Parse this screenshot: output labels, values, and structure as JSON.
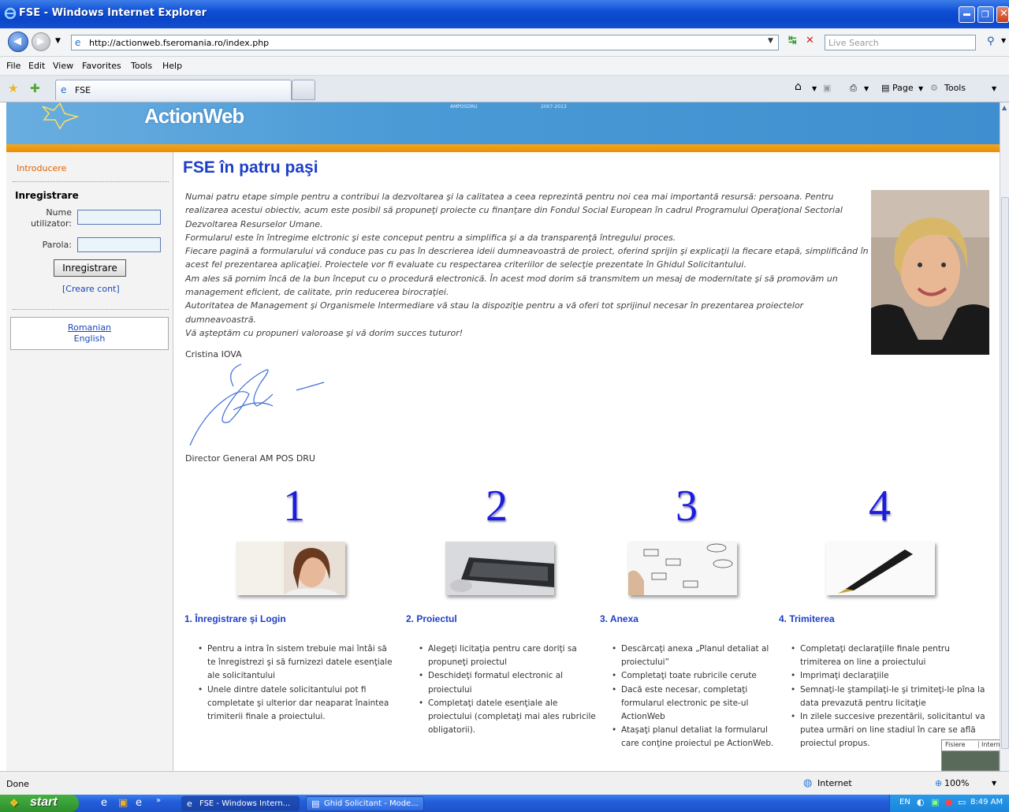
{
  "window": {
    "title": "FSE - Windows Internet Explorer"
  },
  "addressbar": {
    "url": "http://actionweb.fseromania.ro/index.php",
    "search_placeholder": "Live Search"
  },
  "menu": {
    "items": [
      "File",
      "Edit",
      "View",
      "Favorites",
      "Tools",
      "Help"
    ]
  },
  "tabbar": {
    "tab_label": "FSE",
    "page_label": "Page",
    "tools_label": "Tools"
  },
  "banner": {
    "logo": "ActionWeb",
    "small_left": "AMPOSDRU",
    "small_right": "2007-2013"
  },
  "sidebar": {
    "intro": "Introducere",
    "section": "Inregistrare",
    "username_label": "Nume utilizator:",
    "password_label": "Parola:",
    "login_button": "Inregistrare",
    "create_account": "[Creare cont]",
    "languages": [
      "Romanian",
      "English"
    ]
  },
  "content": {
    "heading": "FSE în patru paşi",
    "intro_paragraphs": [
      "Numai patru etape simple pentru a contribui la dezvoltarea şi la calitatea a ceea reprezintă pentru noi cea mai importantă resursă: persoana. Pentru realizarea acestui obiectiv, acum este posibil să propuneţi proiecte cu finanţare din Fondul Social European în cadrul Programului Operaţional Sectorial Dezvoltarea Resurselor Umane.",
      "Formularul este în întregime elctronic şi este conceput pentru a simplifica şi a da transparenţă întregului proces.",
      "Fiecare pagină a formularului vă conduce pas cu pas în descrierea ideii dumneavoastră de proiect, oferind sprijin şi explicaţii la fiecare etapă, simplificând în acest fel prezentarea aplicaţiei. Proiectele vor fi evaluate cu respectarea criteriilor de selecţie prezentate în Ghidul Solicitantului.",
      "Am ales să pornim încă de la bun început cu o procedură electronică. În acest mod dorim să transmitem un mesaj de modernitate şi să promovăm un management eficient, de calitate, prin reducerea birocraţiei.",
      "Autoritatea de Management şi Organismele Intermediare vă stau la dispoziţie pentru a vă oferi tot sprijinul necesar în prezentarea proiectelor dumneavoastră.",
      "Vă aşteptăm cu propuneri valoroase şi vă dorim succes tuturor!"
    ],
    "signer_name": "Cristina IOVA",
    "signer_title": "Director General AM POS DRU"
  },
  "steps": [
    {
      "number": "1",
      "title": "1. Înregistrare şi Login",
      "items": [
        "Pentru a intra în sistem trebuie mai întâi să te înregistrezi şi să furnizezi datele esenţiale ale solicitantului",
        "Unele dintre datele solicitantului pot fi completate şi ulterior dar neaparat înaintea trimiterii finale a proiectului."
      ]
    },
    {
      "number": "2",
      "title": "2. Proiectul",
      "items": [
        "Alegeţi licitaţia pentru care doriţi sa propuneţi proiectul",
        "Deschideţi formatul electronic al proiectului",
        "Completaţi datele esenţiale ale proiectului (completaţi mai ales rubricile obligatorii)."
      ]
    },
    {
      "number": "3",
      "title": "3. Anexa",
      "items": [
        "Descărcaţi anexa „Planul detaliat al proiectului”",
        "Completaţi toate rubricile cerute",
        "Dacă este necesar, completaţi formularul electronic pe site-ul ActionWeb",
        "Ataşaţi planul detaliat la formularul care conţine proiectul pe ActionWeb."
      ]
    },
    {
      "number": "4",
      "title": "4. Trimiterea",
      "items": [
        "Completaţi declaraţiile finale pentru trimiterea on line a proiectului",
        "Imprimaţi declaraţiile",
        "Semnaţi-le ştampilaţi-le şi trimiteţi-le pîna la data prevazută pentru licitaţie",
        "In zilele succesive prezentării, solicitantul va putea urmări on line stadiul în care se află proiectul propus."
      ]
    }
  ],
  "overlay": {
    "tab1": "Fisiere",
    "tab2": "Internet"
  },
  "statusbar": {
    "status": "Done",
    "zone": "Internet",
    "zoom": "100%"
  },
  "taskbar": {
    "start": "start",
    "task1": "FSE - Windows Intern...",
    "task2": "Ghid Solicitant - Mode...",
    "lang": "EN",
    "clock": "8:49 AM"
  },
  "colors": {
    "heading": "#1c3fc8",
    "banner_orange": "#f6a518",
    "link": "#1a47b8",
    "intro_orange": "#e06000"
  }
}
